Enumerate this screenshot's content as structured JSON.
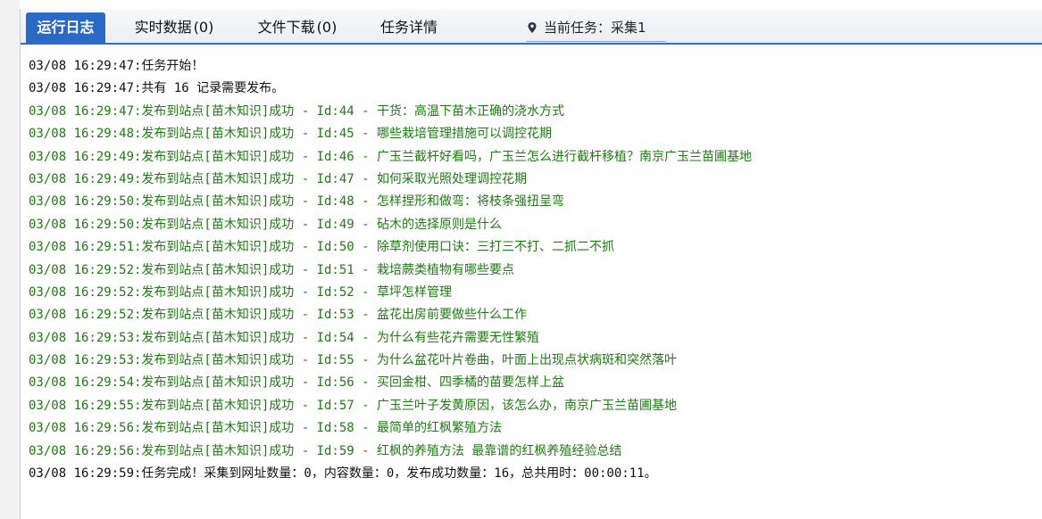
{
  "tabs": [
    {
      "label": "运行日志",
      "count": ""
    },
    {
      "label": "实时数据",
      "count": "(0)"
    },
    {
      "label": "文件下载",
      "count": "(0)"
    },
    {
      "label": "任务详情",
      "count": ""
    }
  ],
  "current_task": {
    "label": "当前任务：",
    "value": "采集1"
  },
  "log": [
    {
      "type": "info",
      "text": "03/08 16:29:47:任务开始！"
    },
    {
      "type": "info",
      "text": "03/08 16:29:47:共有 16 记录需要发布。"
    },
    {
      "type": "success",
      "text": "03/08 16:29:47:发布到站点[苗木知识]成功 - Id:44 - 干货：高温下苗木正确的浇水方式"
    },
    {
      "type": "success",
      "text": "03/08 16:29:48:发布到站点[苗木知识]成功 - Id:45 - 哪些栽培管理措施可以调控花期"
    },
    {
      "type": "success",
      "text": "03/08 16:29:49:发布到站点[苗木知识]成功 - Id:46 - 广玉兰截杆好看吗，广玉兰怎么进行截杆移植？南京广玉兰苗圃基地"
    },
    {
      "type": "success",
      "text": "03/08 16:29:49:发布到站点[苗木知识]成功 - Id:47 - 如何采取光照处理调控花期"
    },
    {
      "type": "success",
      "text": "03/08 16:29:50:发布到站点[苗木知识]成功 - Id:48 - 怎样捏形和做弯：将枝条强扭呈弯"
    },
    {
      "type": "success",
      "text": "03/08 16:29:50:发布到站点[苗木知识]成功 - Id:49 - 砧木的选择原则是什么"
    },
    {
      "type": "success",
      "text": "03/08 16:29:51:发布到站点[苗木知识]成功 - Id:50 - 除草剂使用口诀：三打三不打、二抓二不抓"
    },
    {
      "type": "success",
      "text": "03/08 16:29:52:发布到站点[苗木知识]成功 - Id:51 - 栽培蕨类植物有哪些要点"
    },
    {
      "type": "success",
      "text": "03/08 16:29:52:发布到站点[苗木知识]成功 - Id:52 - 草坪怎样管理"
    },
    {
      "type": "success",
      "text": "03/08 16:29:52:发布到站点[苗木知识]成功 - Id:53 - 盆花出房前要做些什么工作"
    },
    {
      "type": "success",
      "text": "03/08 16:29:53:发布到站点[苗木知识]成功 - Id:54 - 为什么有些花卉需要无性繁殖"
    },
    {
      "type": "success",
      "text": "03/08 16:29:53:发布到站点[苗木知识]成功 - Id:55 - 为什么盆花叶片卷曲，叶面上出现点状病斑和突然落叶"
    },
    {
      "type": "success",
      "text": "03/08 16:29:54:发布到站点[苗木知识]成功 - Id:56 - 买回金柑、四季橘的苗要怎样上盆"
    },
    {
      "type": "success",
      "text": "03/08 16:29:55:发布到站点[苗木知识]成功 - Id:57 - 广玉兰叶子发黄原因，该怎么办，南京广玉兰苗圃基地"
    },
    {
      "type": "success",
      "text": "03/08 16:29:56:发布到站点[苗木知识]成功 - Id:58 - 最简单的红枫繁殖方法"
    },
    {
      "type": "success",
      "text": "03/08 16:29:56:发布到站点[苗木知识]成功 - Id:59 - 红枫的养殖方法 最靠谱的红枫养殖经验总结"
    },
    {
      "type": "info",
      "text": "03/08 16:29:59:任务完成！采集到网址数量：0，内容数量：0，发布成功数量：16，总共用时：00:00:11。"
    }
  ],
  "colors": {
    "active_tab": "#2b69c6",
    "info_text": "#111111",
    "success_text": "#1e7a12"
  },
  "icons": {
    "current_task": "location-pin-icon"
  }
}
